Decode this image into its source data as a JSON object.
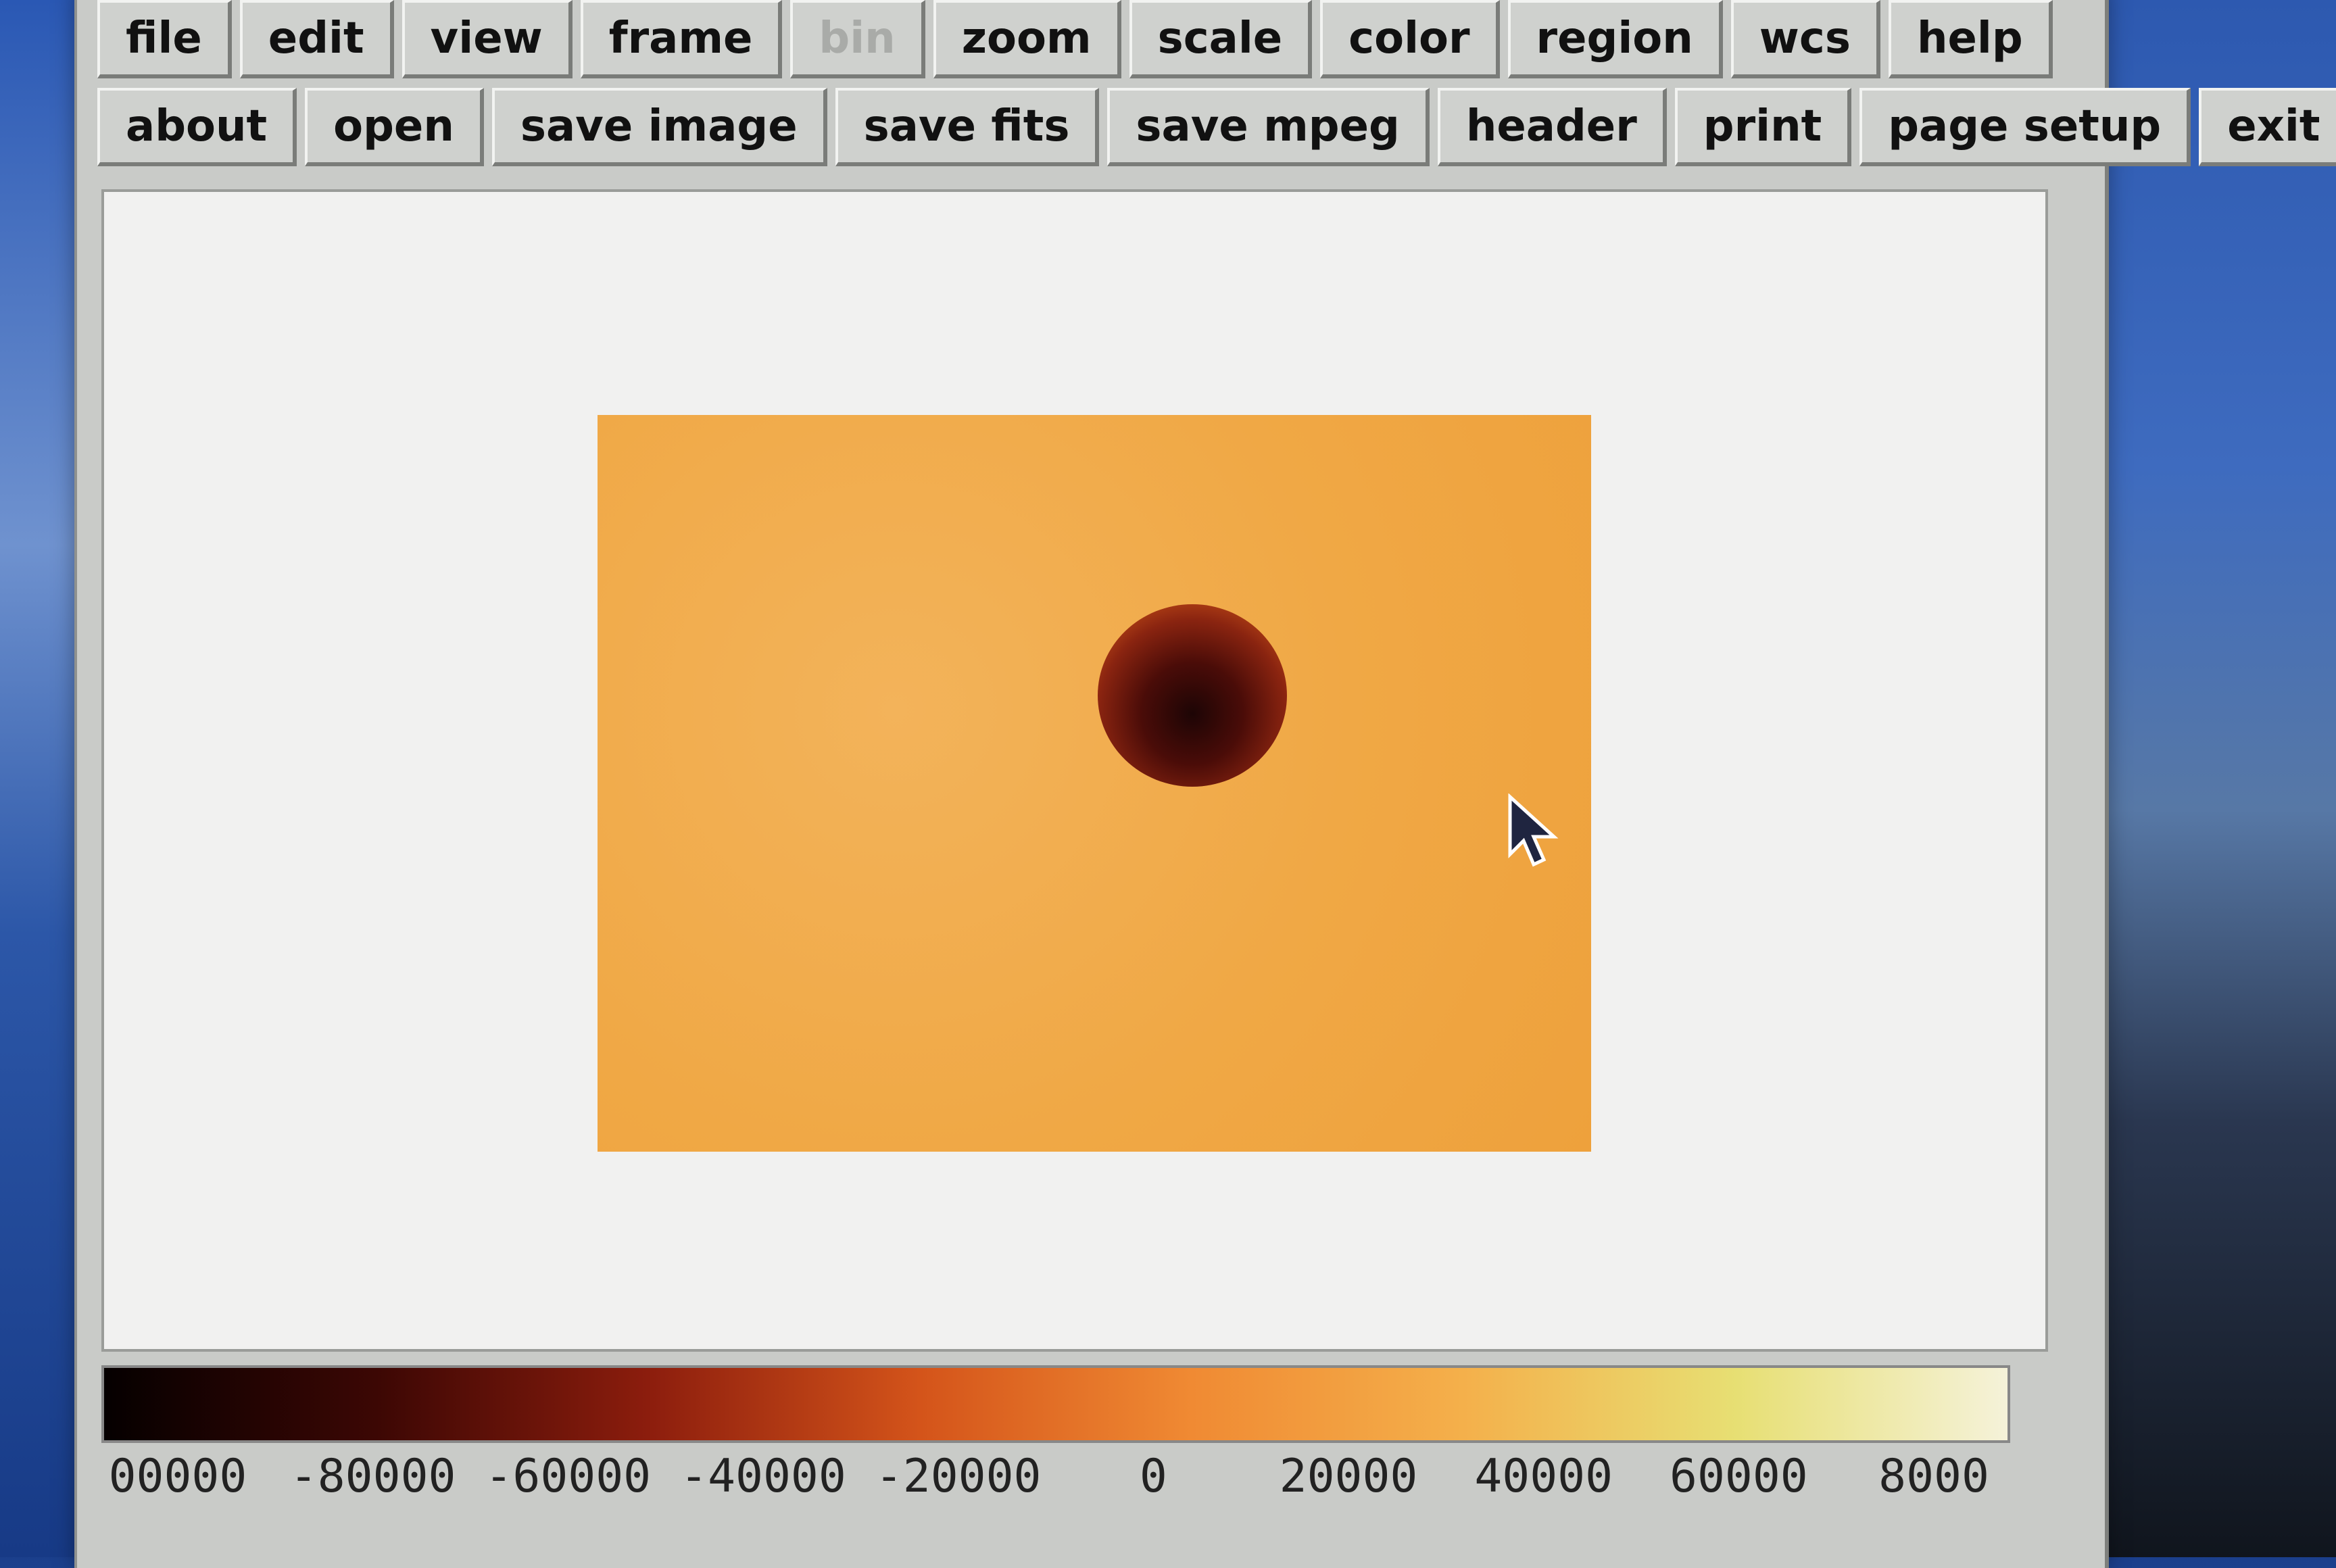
{
  "menu_row": [
    {
      "label": "file",
      "enabled": true
    },
    {
      "label": "edit",
      "enabled": true
    },
    {
      "label": "view",
      "enabled": true
    },
    {
      "label": "frame",
      "enabled": true
    },
    {
      "label": "bin",
      "enabled": false
    },
    {
      "label": "zoom",
      "enabled": true
    },
    {
      "label": "scale",
      "enabled": true
    },
    {
      "label": "color",
      "enabled": true
    },
    {
      "label": "region",
      "enabled": true
    },
    {
      "label": "wcs",
      "enabled": true
    },
    {
      "label": "help",
      "enabled": true
    }
  ],
  "file_row": [
    {
      "label": "about"
    },
    {
      "label": "open"
    },
    {
      "label": "save image"
    },
    {
      "label": "save fits"
    },
    {
      "label": "save mpeg"
    },
    {
      "label": "header"
    },
    {
      "label": "print"
    },
    {
      "label": "page setup"
    },
    {
      "label": "exit"
    }
  ],
  "colorbar": {
    "tick_labels": [
      "00000",
      "-80000",
      "-60000",
      "-40000",
      "-20000",
      "0",
      "20000",
      "40000",
      "60000",
      "8000"
    ],
    "gradient_colors": [
      "#050000",
      "#3c0704",
      "#8c1d0d",
      "#d4541a",
      "#f08a33",
      "#f4b04b",
      "#e7df73",
      "#f5f2d9"
    ]
  },
  "image_colors": {
    "background": "#f0a845",
    "feature_dark": "#1d0505",
    "feature_edge": "#c34d17"
  }
}
